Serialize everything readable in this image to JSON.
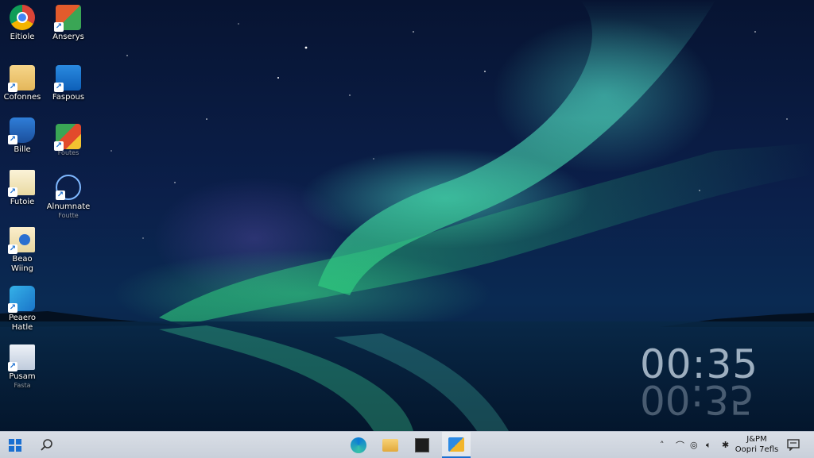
{
  "desktop": {
    "icons": [
      {
        "name": "desktop-icon-chrome",
        "label": "Eitiole",
        "sub": "",
        "icon": "chrome-icon"
      },
      {
        "name": "desktop-icon-anserys",
        "label": "Anserys",
        "sub": "",
        "icon": "app-icon"
      },
      {
        "name": "desktop-icon-cofonnes",
        "label": "Cofonnes",
        "sub": "",
        "icon": "folder-icon"
      },
      {
        "name": "desktop-icon-faspous",
        "label": "Faspous",
        "sub": "",
        "icon": "store-icon"
      },
      {
        "name": "desktop-icon-bille",
        "label": "Bille",
        "sub": "",
        "icon": "shield-icon"
      },
      {
        "name": "desktop-icon-media",
        "label": "",
        "sub": "Foutes",
        "icon": "media-icon"
      },
      {
        "name": "desktop-icon-futoie",
        "label": "Futoie",
        "sub": "",
        "icon": "document-icon"
      },
      {
        "name": "desktop-icon-alnumnate",
        "label": "Alnumnate",
        "sub": "Foutte",
        "icon": "paint-icon"
      },
      {
        "name": "desktop-icon-beao-wiing",
        "label": "Beao\nWiing",
        "sub": "",
        "icon": "notes-icon"
      },
      {
        "name": "desktop-icon-peaero-hatle",
        "label": "Peaero\nHatle",
        "sub": "",
        "icon": "recycle-icon"
      },
      {
        "name": "desktop-icon-pusam",
        "label": "Pusam",
        "sub": "Fasta",
        "icon": "file-icon"
      }
    ],
    "clock": "00:35"
  },
  "taskbar": {
    "start": "windows-start-icon",
    "search": "search-icon",
    "pinned": [
      "edge-icon",
      "file-explorer-icon",
      "terminal-icon",
      "photos-icon"
    ],
    "tray_icons": [
      "chevron-up-icon",
      "wifi-icon",
      "network-icon",
      "volume-icon",
      "bluetooth-icon"
    ],
    "time": "J&PM",
    "date": "Oopri 7efls",
    "notification": "notification-icon"
  },
  "colors": {
    "taskbar_bg": "#d4dae3",
    "accent": "#1a6fd1"
  }
}
